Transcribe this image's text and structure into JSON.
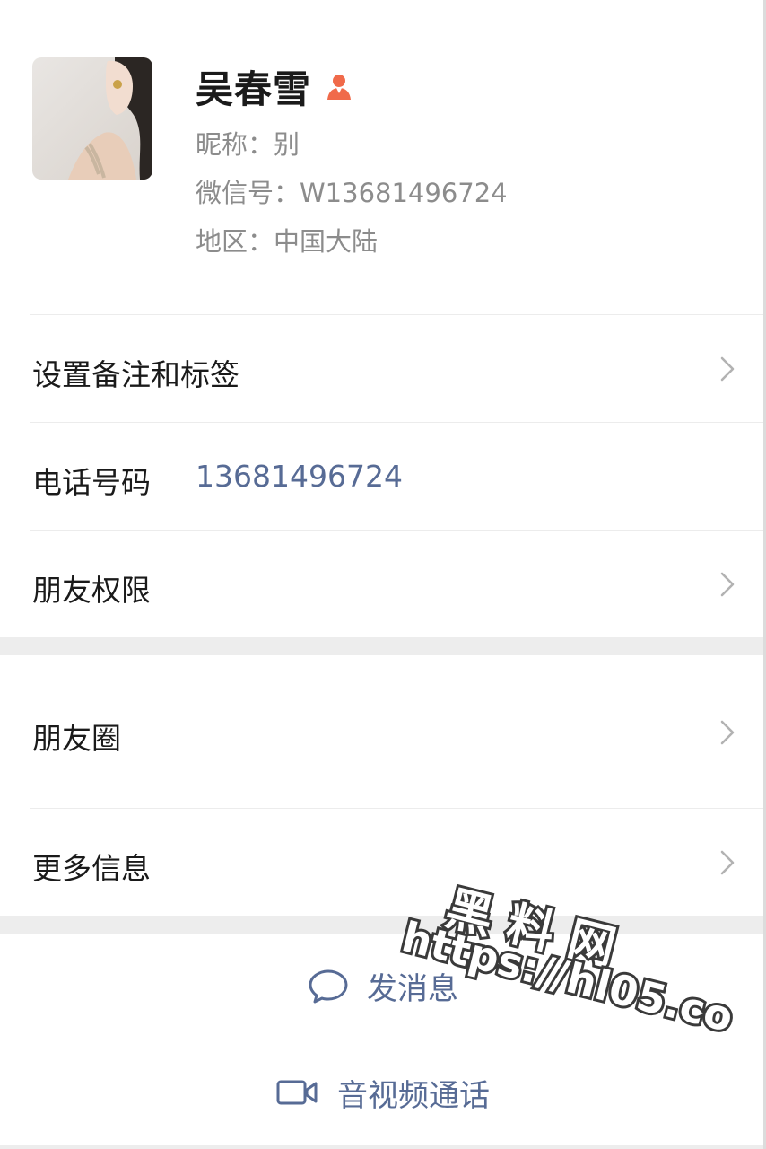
{
  "profile": {
    "name": "吴春雪",
    "nickname": "昵称：别",
    "wechat_id": "微信号：W13681496724",
    "region": "地区：中国大陆"
  },
  "rows": {
    "remark_label": "设置备注和标签",
    "phone_label": "电话号码",
    "phone_value": "13681496724",
    "permissions_label": "朋友权限",
    "moments_label": "朋友圈",
    "more_label": "更多信息"
  },
  "actions": {
    "message_label": "发消息",
    "call_label": "音视频通话"
  },
  "watermark": {
    "line1": "黑料网",
    "line2": "https://hl05.co"
  },
  "colors": {
    "link": "#576b95",
    "gender_icon": "#f06a4a",
    "band": "#ededed"
  },
  "icons": {
    "gender": "female-person-icon",
    "chevron": "chevron-right-icon",
    "message": "chat-bubble-icon",
    "call": "video-camera-icon"
  }
}
